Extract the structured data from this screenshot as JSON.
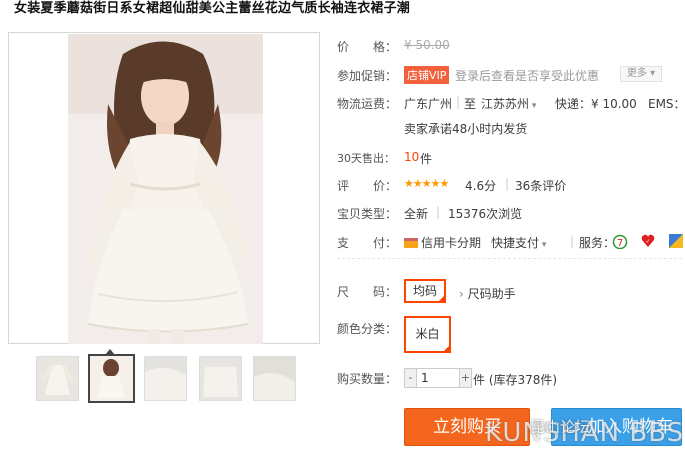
{
  "title": "女装夏季蘑菇街日系女裙超仙甜美公主蕾丝花边气质长袖连衣裙子潮",
  "price": {
    "label": "价　　格：",
    "value": "¥ 50.00"
  },
  "promo": {
    "label": "参加促销：",
    "badge": "店铺VIP",
    "text": "登录后查看是否享受此优惠",
    "more": "更多"
  },
  "shipping": {
    "label": "物流运费：",
    "from": "广东广州",
    "to_word": "至",
    "to": "江苏苏州",
    "express": "快递：¥ 10.00",
    "ems": "EMS：¥",
    "promise": "卖家承诺48小时内发货"
  },
  "sold": {
    "label": "30天售出：",
    "count": "10",
    "unit": "件"
  },
  "rating": {
    "label": "评　　价：",
    "stars": "★★★★★",
    "score": "4.6分",
    "reviews": "36条评价",
    "value": 4.6
  },
  "type": {
    "label": "宝贝类型：",
    "condition": "全新",
    "views": "15376次浏览"
  },
  "payment": {
    "label": "支　　付：",
    "card": "信用卡分期",
    "quick": "快捷支付",
    "service": "服务："
  },
  "size": {
    "label": "尺　　码：",
    "selected": "均码",
    "helper": "尺码助手"
  },
  "color": {
    "label": "颜色分类：",
    "selected": "米白"
  },
  "quantity": {
    "label": "购买数量：",
    "value": "1",
    "unit": "件 (库存378件)",
    "minus": "-",
    "plus": "+"
  },
  "buttons": {
    "buy": "立刻购买",
    "cart": "加入购物车"
  },
  "watermark": {
    "text": "KUNSHAN BBS",
    "sub": "昆山论坛"
  },
  "colors": {
    "accent": "#ff4400",
    "buy": "#f4661d",
    "cart": "#3aa0e8",
    "vip": "#f2603c",
    "star": "#ff9900"
  }
}
